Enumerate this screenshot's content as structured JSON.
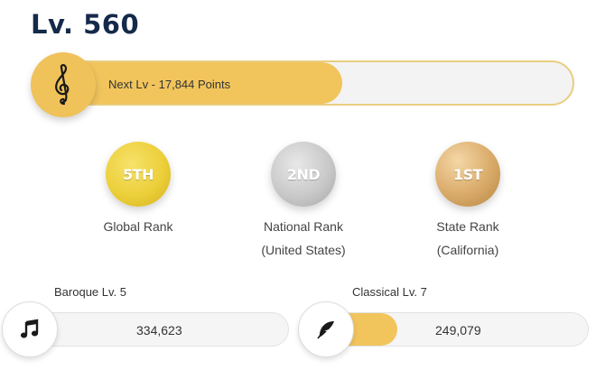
{
  "level": {
    "title": "Lv. 560"
  },
  "progress": {
    "label": "Next Lv - 17,844 Points",
    "fill_fraction": 0.57,
    "icon": "treble-clef-icon",
    "color_fill": "#f1c55c",
    "color_track": "#f3f3f3"
  },
  "ranks": [
    {
      "badge": "5TH",
      "label": "Global Rank",
      "sublabel": "",
      "medal": "gold",
      "icon": "gold-medal"
    },
    {
      "badge": "2ND",
      "label": "National Rank",
      "sublabel": "(United States)",
      "medal": "silver",
      "icon": "silver-medal"
    },
    {
      "badge": "1ST",
      "label": "State Rank",
      "sublabel": "(California)",
      "medal": "bronze",
      "icon": "bronze-medal"
    }
  ],
  "categories": [
    {
      "title": "Baroque Lv. 5",
      "value": "334,623",
      "fill_fraction": 0.0,
      "icon": "music-note-icon"
    },
    {
      "title": "Classical Lv. 7",
      "value": "249,079",
      "fill_fraction": 0.32,
      "icon": "feather-icon"
    }
  ]
}
